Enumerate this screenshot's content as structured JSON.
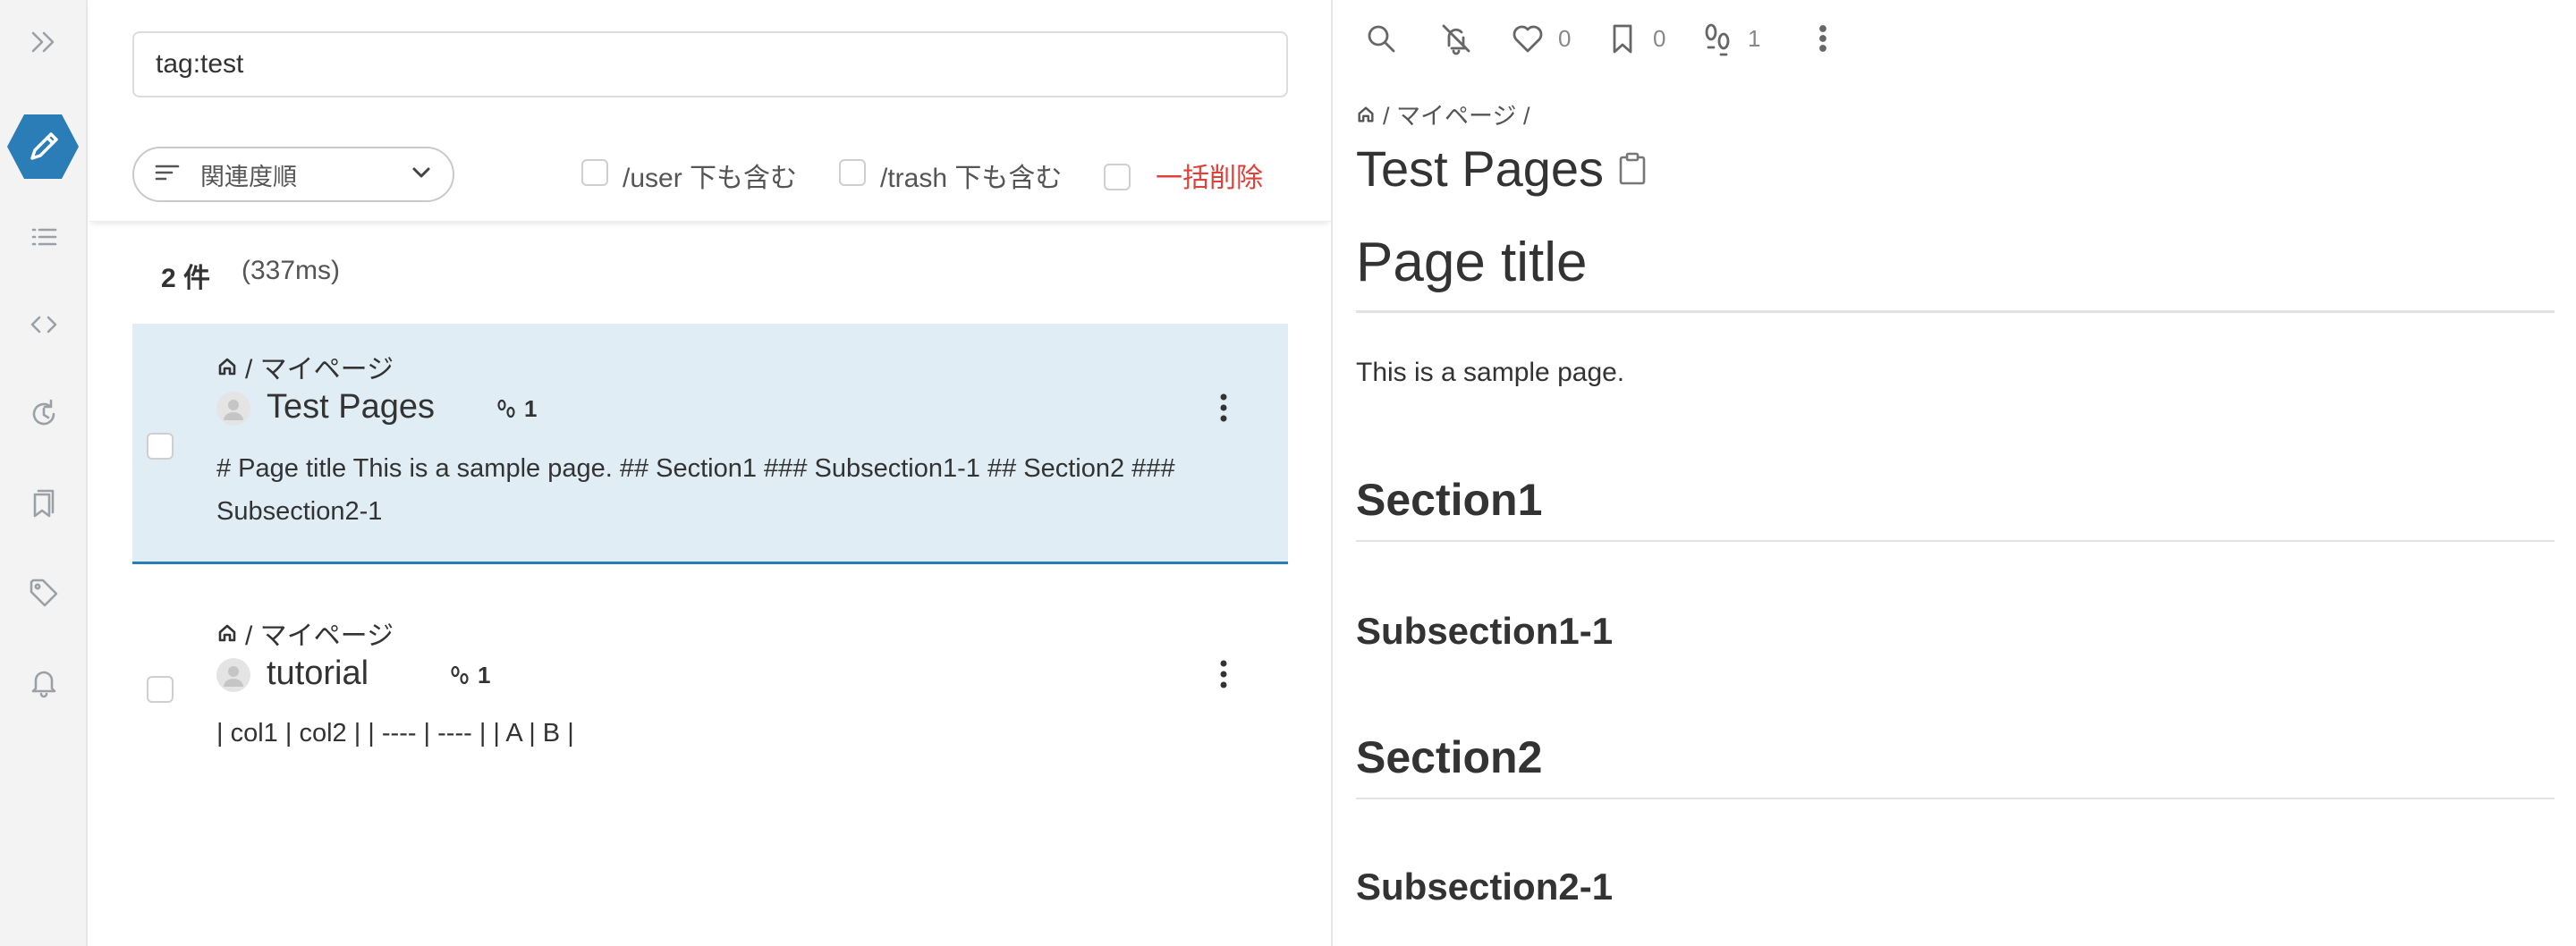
{
  "search": {
    "query": "tag:test",
    "sort_label": "関連度順",
    "include_user_label": "/user 下も含む",
    "include_trash_label": "/trash 下も含む",
    "bulk_delete_label": "一括削除",
    "result_count": "2 件",
    "result_time": "(337ms)"
  },
  "results": [
    {
      "path": "/ マイページ",
      "title": "Test Pages",
      "seen_count": "1",
      "snippet": "# Page title This is a sample page. ## Section1 ### Subsection1-1 ## Section2 ### Subsection2-1",
      "active": true
    },
    {
      "path": "/ マイページ",
      "title": "tutorial",
      "seen_count": "1",
      "snippet": "| col1 | col2 | | ---- | ---- | | A | B |",
      "active": false
    }
  ],
  "preview": {
    "toolbar": {
      "likes": "0",
      "bookmarks": "0",
      "seen_users": "1"
    },
    "breadcrumb": "/ マイページ /",
    "title": "Test Pages",
    "content": {
      "h1": "Page title",
      "paragraph": "This is a sample page.",
      "section1": "Section1",
      "subsection1_1": "Subsection1-1",
      "section2": "Section2",
      "subsection2_1": "Subsection2-1"
    }
  },
  "sidebar": {
    "items": [
      "expand-icon",
      "edit-icon",
      "list-icon",
      "code-icon",
      "recent-icon",
      "bookmarks-icon",
      "tag-icon",
      "notification-icon"
    ]
  },
  "colors": {
    "accent": "#2b7db8",
    "active_row": "#e0edf5",
    "danger": "#e0403a",
    "sidebar_bg": "#f3f3f3"
  }
}
